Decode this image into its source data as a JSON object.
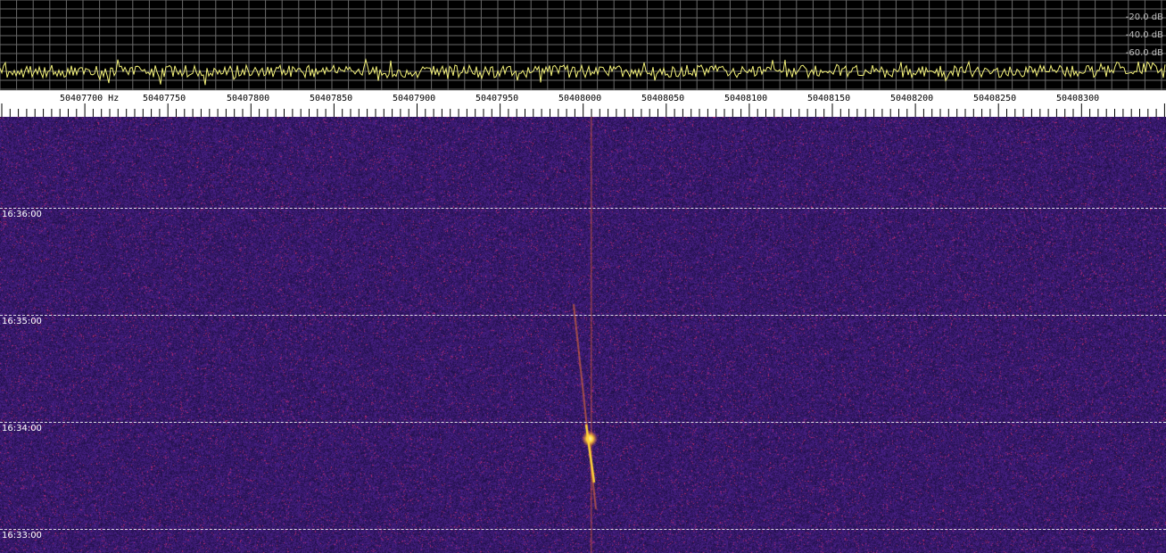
{
  "spectrum": {
    "db_labels": [
      "-20.0 dB",
      "-40.0 dB",
      "-60.0 dB"
    ],
    "colors": {
      "background": "#000000",
      "grid": "#6a6a6a",
      "trace": "#f4f27a"
    }
  },
  "frequency_scale": {
    "labels": [
      "50407700 Hz",
      "50407750",
      "50407800",
      "50407850",
      "50407900",
      "50407950",
      "50408000",
      "50408050",
      "50408100",
      "50408150",
      "50408200",
      "50408250",
      "50408300"
    ]
  },
  "waterfall": {
    "time_labels": [
      "16:36:00",
      "16:35:00",
      "16:34:00",
      "16:33:00"
    ],
    "colors": {
      "background": "#2a1656",
      "signal": "#ffd23a",
      "carrier_line": "#ff6a2a"
    }
  }
}
